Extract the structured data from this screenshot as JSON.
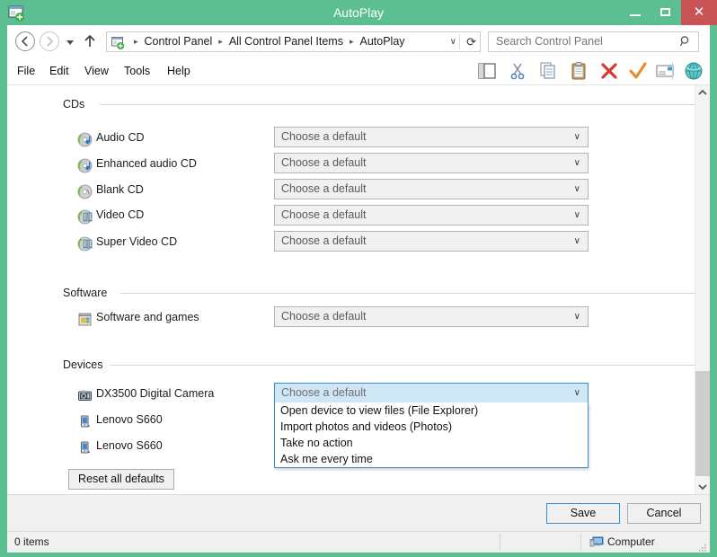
{
  "window": {
    "title": "AutoPlay",
    "icon": "autoplay-icon",
    "minimize_label": "Minimize",
    "maximize_label": "Maximize",
    "close_label": "✕"
  },
  "nav": {
    "back": "←",
    "forward": "→",
    "recent_caret": "▼",
    "up": "↑",
    "breadcrumbs": [
      "Control Panel",
      "All Control Panel Items",
      "AutoPlay"
    ],
    "separator": "▸",
    "address_caret": "∨",
    "refresh": "⟳"
  },
  "search": {
    "placeholder": "Search Control Panel",
    "value": "Search Control Panel",
    "icon": "search-icon"
  },
  "menu": {
    "items": [
      "File",
      "Edit",
      "View",
      "Tools",
      "Help"
    ]
  },
  "toolbar": {
    "icons": [
      "preview-pane-icon",
      "cut-scissors-icon",
      "copy-icon",
      "paste-clipboard-icon",
      "delete-x-icon",
      "checkmark-icon",
      "rename-icon",
      "shell-globe-icon"
    ]
  },
  "content": {
    "groups": [
      {
        "title": "CDs",
        "rows": [
          {
            "icon": "audio-cd-icon",
            "label": "Audio CD",
            "combo": "Choose a default"
          },
          {
            "icon": "enhanced-audio-cd-icon",
            "label": "Enhanced audio CD",
            "combo": "Choose a default"
          },
          {
            "icon": "blank-cd-icon",
            "label": "Blank CD",
            "combo": "Choose a default"
          },
          {
            "icon": "video-cd-icon",
            "label": "Video CD",
            "combo": "Choose a default"
          },
          {
            "icon": "super-video-cd-icon",
            "label": "Super Video CD",
            "combo": "Choose a default"
          }
        ]
      },
      {
        "title": "Software",
        "rows": [
          {
            "icon": "software-games-icon",
            "label": "Software and games",
            "combo": "Choose a default"
          }
        ]
      },
      {
        "title": "Devices",
        "rows": [
          {
            "icon": "digital-camera-icon",
            "label": "DX3500 Digital Camera",
            "combo": "Choose a default"
          },
          {
            "icon": "phone-icon",
            "label": "Lenovo S660",
            "combo": ""
          },
          {
            "icon": "phone-icon",
            "label": "Lenovo S660",
            "combo": ""
          }
        ]
      }
    ],
    "combo_caret": "∨",
    "open_dropdown": {
      "selected": "Choose a default",
      "options": [
        "Open device to view files (File Explorer)",
        "Import photos and videos (Photos)",
        "Take no action",
        "Ask me every time"
      ]
    },
    "reset_button": "Reset all defaults"
  },
  "scrollbar": {
    "up_arrow": "ⱏ",
    "down_arrow": "ⱟ"
  },
  "actions": {
    "save": "Save",
    "cancel": "Cancel"
  },
  "status": {
    "items_count": "0 items",
    "location": "Computer",
    "location_icon": "computer-icon"
  },
  "colors": {
    "titlebar": "#5cbf91",
    "close_button": "#c75354",
    "accent_blue": "#3c8fce",
    "combo_bg": "#f0f0f0",
    "selected_combo_bg": "#cfe6f7"
  }
}
